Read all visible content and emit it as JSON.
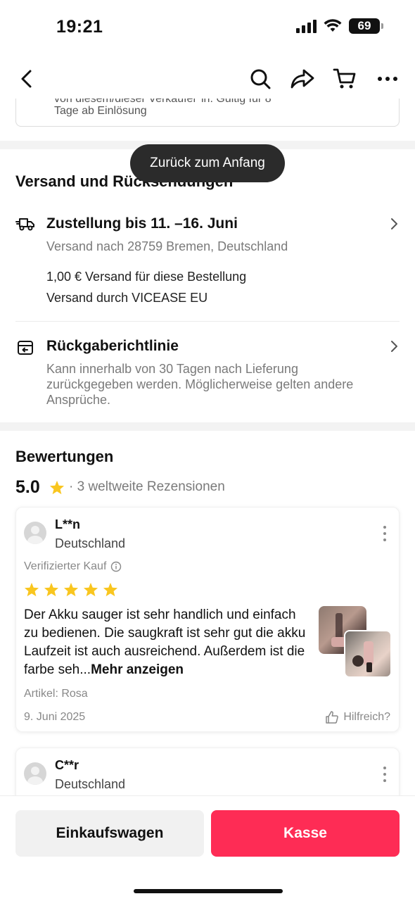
{
  "status_bar": {
    "time": "19:21",
    "battery": "69"
  },
  "nav": {
    "back_icon": "chevron-left-icon",
    "search_icon": "search-icon",
    "share_icon": "share-icon",
    "cart_icon": "cart-icon",
    "more_icon": "more-horizontal-icon"
  },
  "voucher": {
    "line1": "von diesem/dieser Verkäufer*in. Gültig für 8",
    "line2": "Tage ab Einlösung"
  },
  "toast": {
    "label": "Zurück zum Anfang"
  },
  "shipping": {
    "title": "Versand und Rücksendungen",
    "delivery_title": "Zustellung bis 11. –16. Juni",
    "delivery_sub": "Versand nach 28759 Bremen, Deutschland",
    "cost": "1,00 € Versand für diese Bestellung",
    "carrier": "Versand durch VICEASE EU",
    "return_title": "Rückgaberichtlinie",
    "return_sub": "Kann innerhalb von 30 Tagen nach Lieferung zurückgegeben werden. Möglicherweise gelten andere Ansprüche."
  },
  "reviews": {
    "title": "Bewertungen",
    "score": "5.0",
    "count_text": "· 3 weltweite Rezensionen",
    "items": [
      {
        "name": "L**n",
        "country": "Deutschland",
        "verified": "Verifizierter Kauf",
        "stars": 5,
        "body": "Der Akku sauger ist sehr handlich und einfach zu bedienen. Die saugkraft ist sehr gut die akku Laufzeit ist auch ausreichend. Außerdem ist die farbe seh...",
        "more": "Mehr anzeigen",
        "article": "Artikel: Rosa",
        "date": "9. Juni 2025",
        "helpful": "Hilfreich?"
      },
      {
        "name": "C**r",
        "country": "Deutschland"
      }
    ]
  },
  "bottom": {
    "cart_label": "Einkaufswagen",
    "checkout_label": "Kasse"
  },
  "colors": {
    "accent": "#fe2c55",
    "star": "#f9c61f"
  }
}
